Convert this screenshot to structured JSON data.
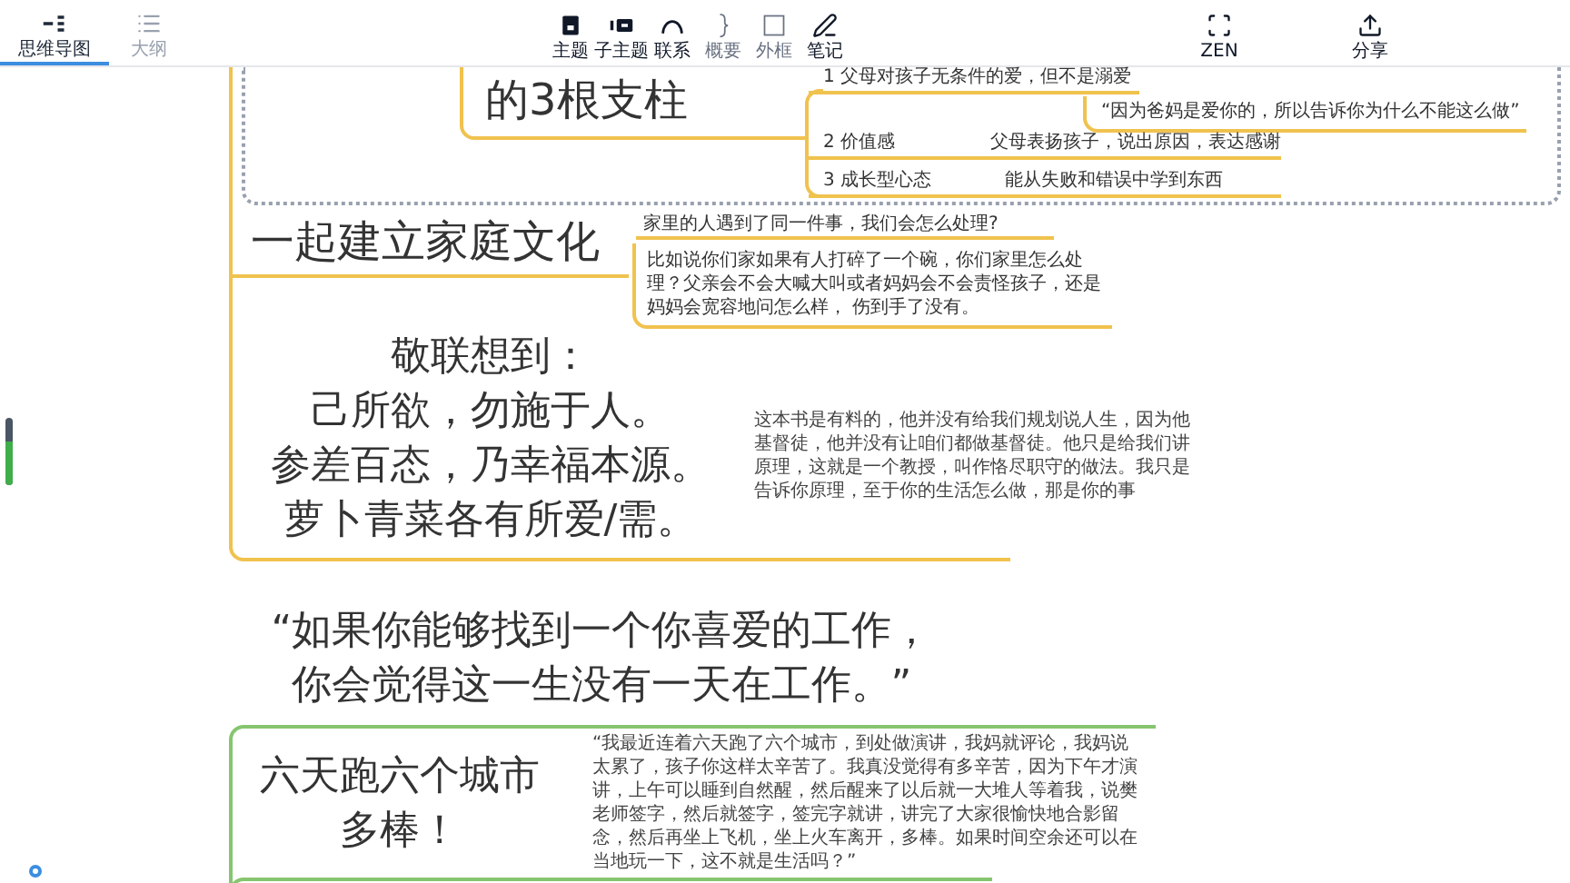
{
  "toolbar": {
    "views": [
      {
        "label": "思维导图",
        "kind": "mindmap",
        "selected": true
      },
      {
        "label": "大纲",
        "kind": "outline",
        "selected": false
      }
    ],
    "tools": [
      {
        "label": "主题",
        "kind": "topic",
        "disabled": false
      },
      {
        "label": "子主题",
        "kind": "subtopic",
        "disabled": false
      },
      {
        "label": "联系",
        "kind": "relationship",
        "disabled": false
      },
      {
        "label": "概要",
        "kind": "summary",
        "disabled": true
      },
      {
        "label": "外框",
        "kind": "boundary",
        "disabled": true
      },
      {
        "label": "笔记",
        "kind": "notes",
        "disabled": false
      }
    ],
    "right_tools": [
      {
        "label": "ZEN",
        "kind": "zen"
      },
      {
        "label": "分享",
        "kind": "share"
      }
    ]
  },
  "pillars": {
    "title": "的3根支柱",
    "items": [
      {
        "label": "1 父母对孩子无条件的爱，但不是溺爱",
        "note": "“因为爸妈是爱你的，所以告诉你为什么不能这么做”"
      },
      {
        "label": "2 价值感",
        "note": "父母表扬孩子，说出原因，表达感谢"
      },
      {
        "label": "3 成长型心态",
        "note": "能从失败和错误中学到东西"
      }
    ]
  },
  "family_culture": {
    "title": "一起建立家庭文化",
    "question": "家里的人遇到了同一件事，我们会怎么处理?",
    "example": "比如说你们家如果有人打碎了一个碗，你们家里怎么处理？父亲会不会大喊大叫或者妈妈会不会责怪孩子，还是妈妈会宽容地问怎么样， 伤到手了没有。"
  },
  "reflection": {
    "lines": [
      "敬联想到：",
      "己所欲，勿施于人。",
      "参差百态，乃幸福本源。",
      "萝卜青菜各有所爱/需。"
    ],
    "note": "这本书是有料的，他并没有给我们规划说人生，因为他基督徒，他并没有让咱们都做基督徒。他只是给我们讲原理，这就是一个教授，叫作恪尽职守的做法。我只是告诉你原理，至于你的生活怎么做，那是你的事"
  },
  "quote": {
    "lines": [
      "“如果你能够找到一个你喜爱的工作，",
      "你会觉得这一生没有一天在工作。”"
    ]
  },
  "six_cities": {
    "title_lines": [
      "六天跑六个城市",
      "多棒！"
    ],
    "note": "“我最近连着六天跑了六个城市，到处做演讲，我妈就评论，我妈说太累了，孩子你这样太辛苦了。我真没觉得有多辛苦，因为下午才演讲，上午可以睡到自然醒，然后醒来了以后就一大堆人等着我，说樊老师签字，然后就签字，签完字就讲，讲完了大家很愉快地合影留念，然后再坐上飞机，坐上火车离开，多棒。如果时间空余还可以在当地玩一下，这不就是生活吗？”"
  },
  "zoom_slider": {
    "level": 0.65
  }
}
